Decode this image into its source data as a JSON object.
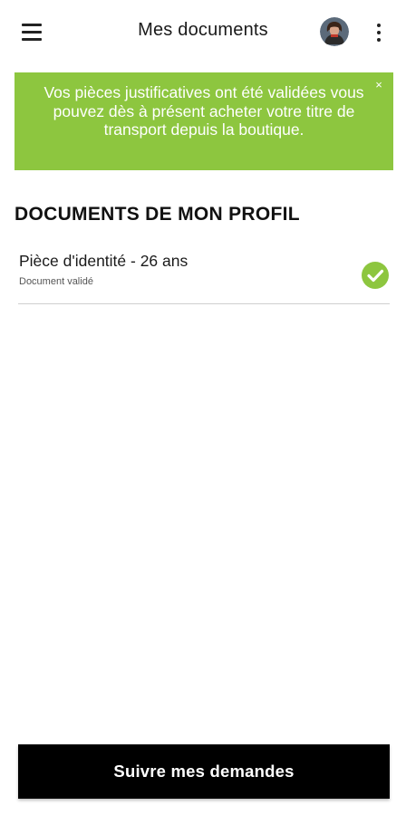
{
  "header": {
    "title": "Mes documents",
    "menu_icon": "hamburger-menu-icon",
    "avatar_icon": "user-avatar",
    "more_icon": "more-vertical-icon"
  },
  "banner": {
    "message": "Vos pièces justificatives ont été validées vous pouvez dès à présent acheter votre titre de transport depuis la boutique.",
    "close_label": "×",
    "background_color": "#8dc63f"
  },
  "section": {
    "title": "DOCUMENTS DE MON PROFIL"
  },
  "documents": [
    {
      "name": "Pièce d'identité - 26 ans",
      "status": "Document validé",
      "status_icon": "check-circle-icon",
      "status_color": "#8dc63f"
    }
  ],
  "footer": {
    "button_label": "Suivre mes demandes"
  }
}
